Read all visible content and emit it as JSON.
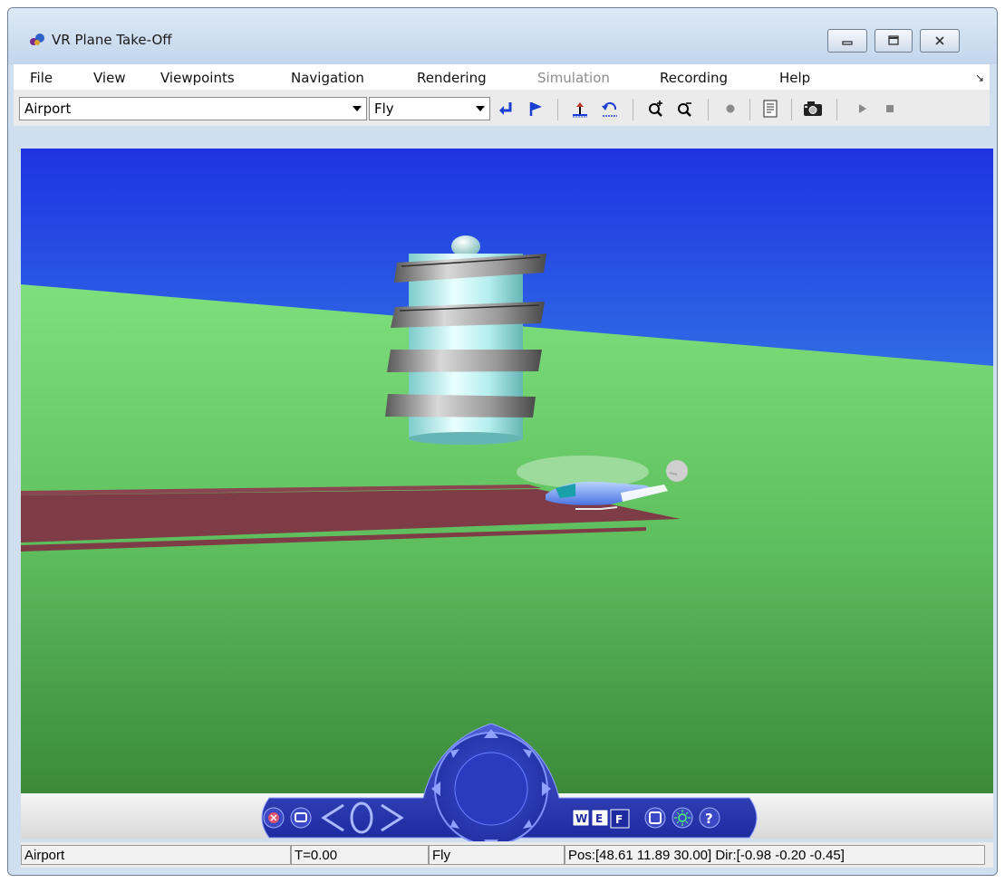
{
  "window": {
    "title": "VR Plane Take-Off"
  },
  "menu": {
    "items": [
      {
        "label": "File",
        "enabled": true
      },
      {
        "label": "View",
        "enabled": true
      },
      {
        "label": "Viewpoints",
        "enabled": true
      },
      {
        "label": "Navigation",
        "enabled": true
      },
      {
        "label": "Rendering",
        "enabled": true
      },
      {
        "label": "Simulation",
        "enabled": false
      },
      {
        "label": "Recording",
        "enabled": true
      },
      {
        "label": "Help",
        "enabled": true
      }
    ],
    "dock_icon": "undock-arrow-icon"
  },
  "toolbar": {
    "viewpoint_value": "Airport",
    "navmode_value": "Fly",
    "icons": [
      "return-to-viewpoint-icon",
      "flag-icon",
      "straighten-up-icon",
      "undo-move-icon",
      "zoom-in-icon",
      "zoom-out-icon",
      "record-icon",
      "capture-frame-icon",
      "snapshot-camera-icon",
      "play-icon",
      "stop-icon"
    ]
  },
  "scene": {
    "sky_colors": [
      "#1f3ae0",
      "#4fc6e8"
    ],
    "ground_colors": [
      "#7de07a",
      "#3f8f3f"
    ],
    "runway_color": "#7e3c46",
    "objects": [
      "control-tower",
      "airplane",
      "runway"
    ]
  },
  "nav_panel": {
    "letters": {
      "w": "W",
      "e": "E",
      "f": "F"
    },
    "help": "?",
    "icons": [
      "close-panel-icon",
      "minimize-panel-icon",
      "previous-viewpoint-icon",
      "home-viewpoint-icon",
      "next-viewpoint-icon",
      "navigation-wheel-icon",
      "walk-mode-icon",
      "examine-mode-icon",
      "fly-mode-icon",
      "wireframe-icon",
      "headlight-icon",
      "help-icon"
    ]
  },
  "status": {
    "viewpoint": "Airport",
    "time": "T=0.00",
    "mode": "Fly",
    "position": "Pos:[48.61 11.89 30.00] Dir:[-0.98 -0.20 -0.45]"
  }
}
